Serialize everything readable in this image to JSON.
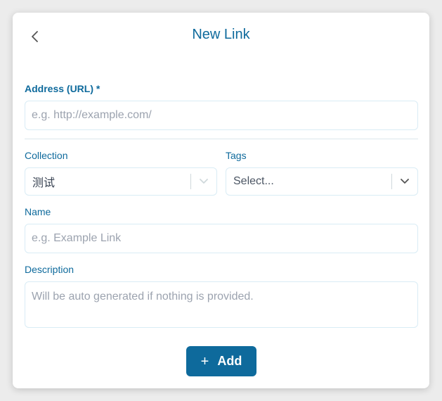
{
  "header": {
    "title": "New Link"
  },
  "fields": {
    "address": {
      "label": "Address (URL) *",
      "placeholder": "e.g. http://example.com/"
    },
    "collection": {
      "label": "Collection",
      "value": "测试"
    },
    "tags": {
      "label": "Tags",
      "placeholder": "Select..."
    },
    "name": {
      "label": "Name",
      "placeholder": "e.g. Example Link"
    },
    "description": {
      "label": "Description",
      "placeholder": "Will be auto generated if nothing is provided."
    }
  },
  "actions": {
    "add_label": "Add",
    "add_icon": "plus-icon"
  },
  "colors": {
    "accent": "#0e6a9c",
    "border": "#d9ecf5",
    "placeholder": "#9ca3af",
    "text": "#374151"
  }
}
